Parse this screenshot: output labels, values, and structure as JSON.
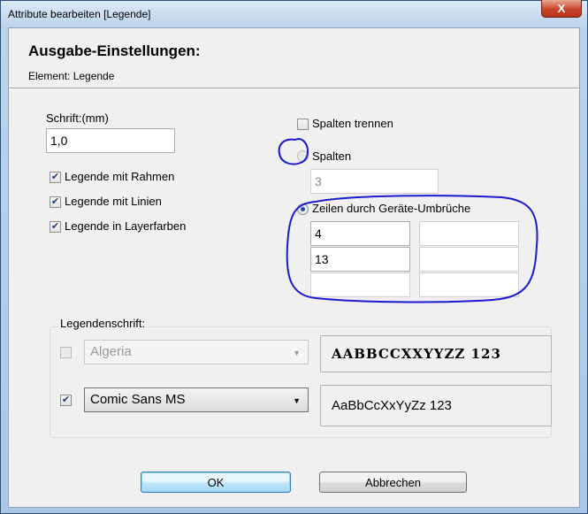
{
  "window": {
    "title": "Attribute bearbeiten [Legende]",
    "close_glyph": "X"
  },
  "header": {
    "title": "Ausgabe-Einstellungen:",
    "element_label": "Element: Legende"
  },
  "font_size": {
    "label": "Schrift:(mm)",
    "value": "1,0"
  },
  "options": {
    "frame": {
      "label": "Legende mit Rahmen",
      "checked": true
    },
    "lines": {
      "label": "Legende mit Linien",
      "checked": true
    },
    "layer_colors": {
      "label": "Legende in Layerfarben",
      "checked": true
    }
  },
  "layout": {
    "split_columns": {
      "label": "Spalten trennen",
      "checked": false
    },
    "columns": {
      "label": "Spalten",
      "selected": false,
      "value": "3"
    },
    "rows_by_device_breaks": {
      "label": "Zeilen durch Geräte-Umbrüche",
      "selected": true,
      "values": [
        "4",
        "",
        "13",
        "",
        "",
        ""
      ]
    }
  },
  "legend_font": {
    "group_label": "Legendenschrift:",
    "primary": {
      "checked": false,
      "font": "Algeria",
      "preview": "AABBCCXXYYZZ 123"
    },
    "secondary": {
      "checked": true,
      "font": "Comic Sans MS",
      "preview": "AaBbCcXxYyZz 123"
    }
  },
  "buttons": {
    "ok": "OK",
    "cancel": "Abbrechen"
  },
  "colors": {
    "annotation_ink": "#1a1ad0",
    "accent_blue": "#3c7fb1"
  }
}
